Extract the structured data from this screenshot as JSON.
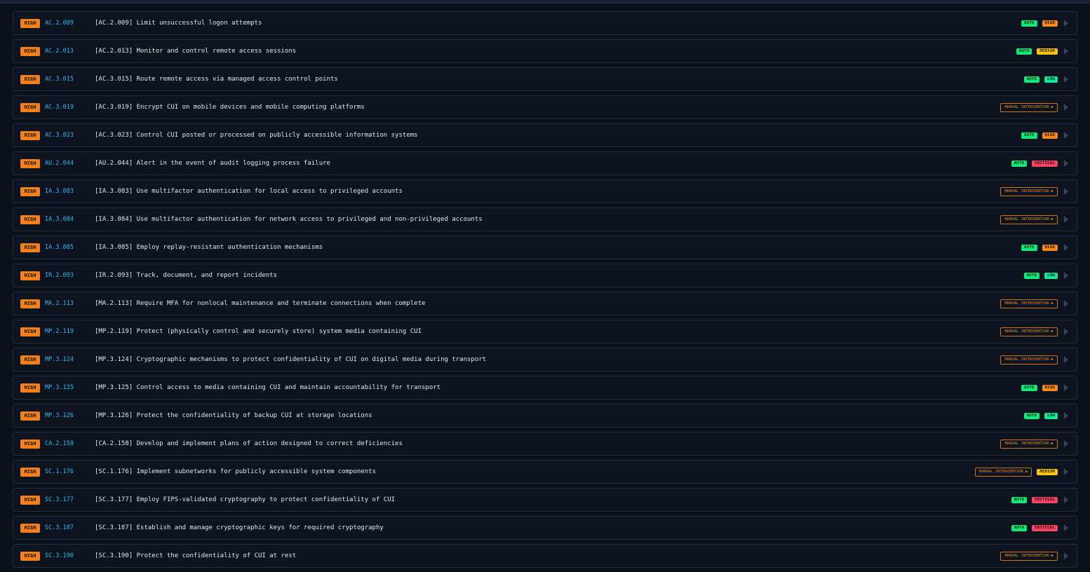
{
  "colors": {
    "background": "#0b111b",
    "row_background": "#0d1420",
    "row_border": "#232f41",
    "severity_high": "#f3801c",
    "control_id": "#38b9f5",
    "auto": "#16e676",
    "risk_high": "#f5861c",
    "risk_medium": "#f5c418",
    "risk_low": "#16e696",
    "risk_critical": "#f0455f",
    "manual": "#d0741c"
  },
  "labels": {
    "auto": "AUTO",
    "manual": "MANUAL INTERVENTION ▶",
    "run_icon": "play-icon"
  },
  "rows": [
    {
      "severity": "HIGH",
      "id": "AC.2.009",
      "title": "[AC.2.009] Limit unsuccessful logon attempts",
      "auto": true,
      "risk": "HIGH"
    },
    {
      "severity": "HIGH",
      "id": "AC.2.013",
      "title": "[AC.2.013] Monitor and control remote access sessions",
      "auto": true,
      "risk": "MEDIUM"
    },
    {
      "severity": "HIGH",
      "id": "AC.3.015",
      "title": "[AC.3.015] Route remote access via managed access control points",
      "auto": true,
      "risk": "LOW"
    },
    {
      "severity": "HIGH",
      "id": "AC.3.019",
      "title": "[AC.3.019] Encrypt CUI on mobile devices and mobile computing platforms",
      "auto": false,
      "manual": true,
      "risk": null
    },
    {
      "severity": "HIGH",
      "id": "AC.3.023",
      "title": "[AC.3.023] Control CUI posted or processed on publicly accessible information systems",
      "auto": true,
      "risk": "HIGH"
    },
    {
      "severity": "HIGH",
      "id": "AU.2.044",
      "title": "[AU.2.044] Alert in the event of audit logging process failure",
      "auto": true,
      "risk": "CRITICAL"
    },
    {
      "severity": "HIGH",
      "id": "IA.3.083",
      "title": "[IA.3.083] Use multifactor authentication for local access to privileged accounts",
      "auto": false,
      "manual": true,
      "risk": null
    },
    {
      "severity": "HIGH",
      "id": "IA.3.084",
      "title": "[IA.3.084] Use multifactor authentication for network access to privileged and non-privileged accounts",
      "auto": false,
      "manual": true,
      "risk": null
    },
    {
      "severity": "HIGH",
      "id": "IA.3.085",
      "title": "[IA.3.085] Employ replay-resistant authentication mechanisms",
      "auto": true,
      "risk": "HIGH"
    },
    {
      "severity": "HIGH",
      "id": "IR.2.093",
      "title": "[IR.2.093] Track, document, and report incidents",
      "auto": true,
      "risk": "LOW"
    },
    {
      "severity": "HIGH",
      "id": "MA.2.113",
      "title": "[MA.2.113] Require MFA for nonlocal maintenance and terminate connections when complete",
      "auto": false,
      "manual": true,
      "risk": null
    },
    {
      "severity": "HIGH",
      "id": "MP.2.119",
      "title": "[MP.2.119] Protect (physically control and securely store) system media containing CUI",
      "auto": false,
      "manual": true,
      "risk": null
    },
    {
      "severity": "HIGH",
      "id": "MP.3.124",
      "title": "[MP.3.124] Cryptographic mechanisms to protect confidentiality of CUI on digital media during transport",
      "auto": false,
      "manual": true,
      "risk": null
    },
    {
      "severity": "HIGH",
      "id": "MP.3.125",
      "title": "[MP.3.125] Control access to media containing CUI and maintain accountability for transport",
      "auto": true,
      "risk": "HIGH"
    },
    {
      "severity": "HIGH",
      "id": "MP.3.126",
      "title": "[MP.3.126] Protect the confidentiality of backup CUI at storage locations",
      "auto": true,
      "risk": "LOW"
    },
    {
      "severity": "HIGH",
      "id": "CA.2.158",
      "title": "[CA.2.158] Develop and implement plans of action designed to correct deficiencies",
      "auto": false,
      "manual": true,
      "risk": null
    },
    {
      "severity": "HIGH",
      "id": "SC.1.176",
      "title": "[SC.1.176] Implement subnetworks for publicly accessible system components",
      "auto": false,
      "manual": true,
      "risk": "MEDIUM"
    },
    {
      "severity": "HIGH",
      "id": "SC.3.177",
      "title": "[SC.3.177] Employ FIPS-validated cryptography to protect confidentiality of CUI",
      "auto": true,
      "risk": "CRITICAL"
    },
    {
      "severity": "HIGH",
      "id": "SC.3.187",
      "title": "[SC.3.187] Establish and manage cryptographic keys for required cryptography",
      "auto": true,
      "risk": "CRITICAL"
    },
    {
      "severity": "HIGH",
      "id": "SC.3.190",
      "title": "[SC.3.190] Protect the confidentiality of CUI at rest",
      "auto": false,
      "manual": true,
      "risk": null
    }
  ]
}
